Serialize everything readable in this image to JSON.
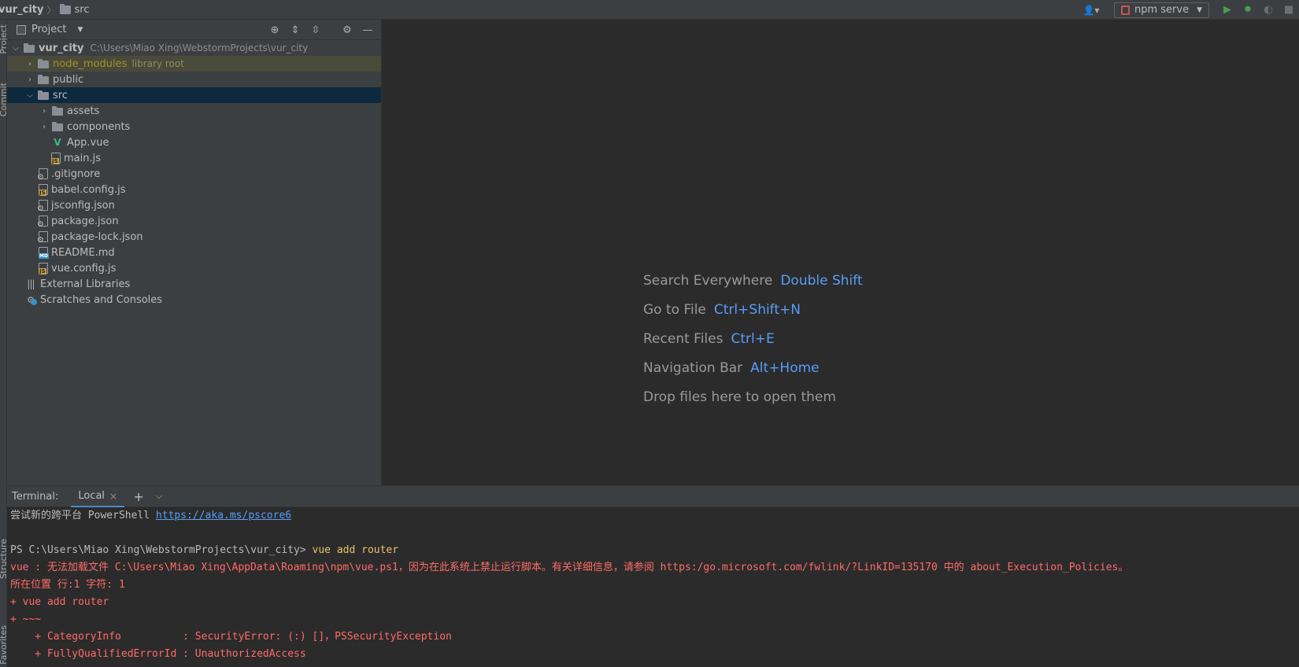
{
  "breadcrumb": {
    "root": "vur_city",
    "child": "src"
  },
  "run": {
    "config_label": "npm serve"
  },
  "strip": {
    "project": "Project",
    "commit": "Commit",
    "structure": "Structure",
    "favorites": "Favorites"
  },
  "project": {
    "title": "Project",
    "root": {
      "name": "vur_city",
      "path": "C:\\Users\\Miao Xing\\WebstormProjects\\vur_city"
    },
    "node_modules": {
      "name": "node_modules",
      "hint": "library root"
    },
    "items": {
      "public": "public",
      "src": "src",
      "assets": "assets",
      "components": "components",
      "app_vue": "App.vue",
      "main_js": "main.js",
      "gitignore": ".gitignore",
      "babel": "babel.config.js",
      "jsconfig": "jsconfig.json",
      "package": "package.json",
      "package_lock": "package-lock.json",
      "readme": "README.md",
      "vue_config": "vue.config.js",
      "external": "External Libraries",
      "scratches": "Scratches and Consoles"
    }
  },
  "editor_hints": [
    {
      "label": "Search Everywhere",
      "shortcut": "Double Shift"
    },
    {
      "label": "Go to File",
      "shortcut": "Ctrl+Shift+N"
    },
    {
      "label": "Recent Files",
      "shortcut": "Ctrl+E"
    },
    {
      "label": "Navigation Bar",
      "shortcut": "Alt+Home"
    },
    {
      "label": "Drop files here to open them",
      "shortcut": ""
    }
  ],
  "terminal": {
    "title": "Terminal:",
    "tab": "Local",
    "line1_text": "尝试新的跨平台 PowerShell ",
    "line1_link": "https://aka.ms/pscore6",
    "prompt": "PS C:\\Users\\Miao Xing\\WebstormProjects\\vur_city> ",
    "command": "vue add router",
    "err1": "vue : 无法加载文件 C:\\Users\\Miao Xing\\AppData\\Roaming\\npm\\vue.ps1，因为在此系统上禁止运行脚本。有关详细信息，请参阅 https:/go.microsoft.com/fwlink/?LinkID=135170 中的 about_Execution_Policies。",
    "err2": "所在位置 行:1 字符: 1",
    "err3": "+ vue add router",
    "err4": "+ ~~~",
    "err5": "    + CategoryInfo          : SecurityError: (:) []，PSSecurityException",
    "err6": "    + FullyQualifiedErrorId : UnauthorizedAccess"
  }
}
